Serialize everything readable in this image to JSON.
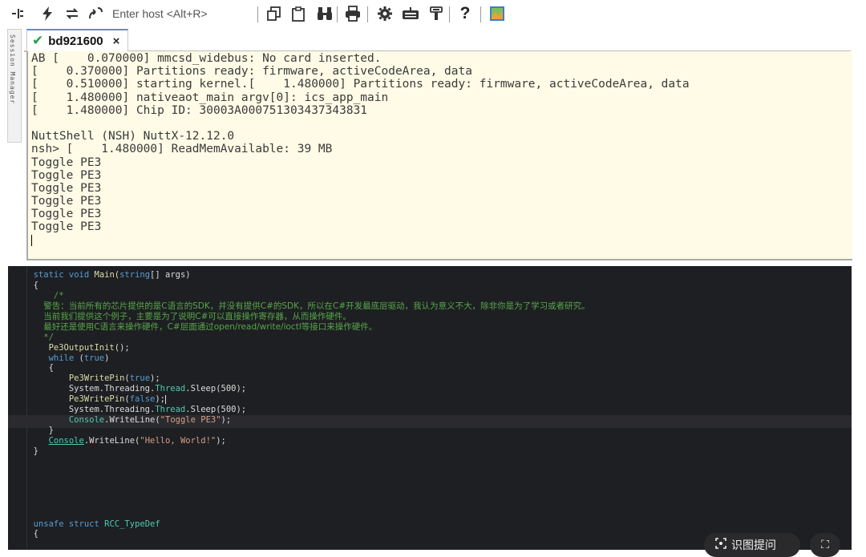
{
  "toolbar": {
    "host_placeholder": "Enter host <Alt+R>",
    "icons": [
      "quick-connect-icon",
      "lightning-icon",
      "reconnect-icon",
      "session-link-icon",
      "copy-icon",
      "paste-icon",
      "find-binoculars-icon",
      "print-icon",
      "settings-gear-icon",
      "keymap-icon",
      "sftp-icon",
      "help-icon",
      "map-icon"
    ]
  },
  "side_panel": {
    "label": "Session Manager"
  },
  "tab": {
    "label": "bd921600",
    "status_icon": "check-icon",
    "close_label": "×"
  },
  "console": {
    "lines": [
      "AB [    0.070000] mmcsd_widebus: No card inserted.",
      "[    0.370000] Partitions ready: firmware, activeCodeArea, data",
      "[    0.510000] starting kernel.[    1.480000] Partitions ready: firmware, activeCodeArea, data",
      "[    1.480000] nativeaot_main argv[0]: ics_app_main",
      "[    1.480000] Chip ID: 30003A000751303437343831",
      "",
      "NuttShell (NSH) NuttX-12.12.0",
      "nsh> [    1.480000] ReadMemAvailable: 39 MB",
      "Toggle PE3",
      "Toggle PE3",
      "Toggle PE3",
      "Toggle PE3",
      "Toggle PE3",
      "Toggle PE3"
    ]
  },
  "code": {
    "l01_static": "static",
    "l01_void": "void",
    "l01_name": "Main(",
    "l01_type": "string",
    "l01_rest": "[] args)",
    "l02": "{",
    "l03": "/*",
    "l04": "警告：当前所有的芯片提供的是C语言的SDK，并没有提供C#的SDK，所以在C#开发最底层驱动，我认为意义不大，除非你是为了学习或者研究。",
    "l05": "当前我们提供这个例子，主要是为了说明C#可以直接操作寄存器，从而操作硬件。",
    "l06": "最好还是使用C语言来操作硬件，C#层面通过open/read/write/ioctl等接口来操作硬件。",
    "l07": "*/",
    "l08_fn": "Pe3OutputInit",
    "l08_rest": "();",
    "l09_while": "while",
    "l09_open": " (",
    "l09_true": "true",
    "l09_close": ")",
    "l10": "{",
    "l11_fn": "Pe3WritePin",
    "l11_open": "(",
    "l11_val": "true",
    "l11_close": ");",
    "l12_ns": "System.Threading.",
    "l12_cls": "Thread",
    "l12_rest": ".Sleep(500);",
    "l13_fn": "Pe3WritePin",
    "l13_open": "(",
    "l13_val": "false",
    "l13_close": ");",
    "l14_ns": "System.Threading.",
    "l14_cls": "Thread",
    "l14_rest": ".Sleep(500);",
    "l15_cls": "Console",
    "l15_mid": ".WriteLine(",
    "l15_str": "\"Toggle PE3\"",
    "l15_close": ");",
    "l16": "}",
    "l17_cls": "Console",
    "l17_mid": ".WriteLine(",
    "l17_str": "\"Hello, World!\"",
    "l17_close": ");",
    "l18": "}",
    "l19_unsafe": "unsafe",
    "l19_struct": "struct",
    "l19_name": "RCC_TypeDef",
    "l20": "{"
  },
  "overlay": {
    "lookup_label": "识图提问",
    "expand_label": "⛶"
  }
}
